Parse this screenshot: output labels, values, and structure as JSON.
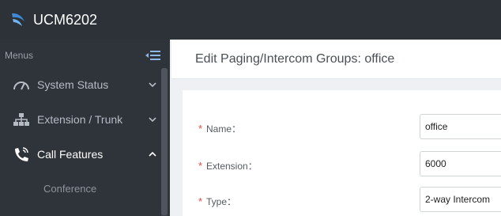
{
  "app": {
    "title": "UCM6202"
  },
  "sidebar": {
    "menus_label": "Menus",
    "items": [
      {
        "label": "System Status",
        "icon": "gauge-icon",
        "expanded": false
      },
      {
        "label": "Extension / Trunk",
        "icon": "network-icon",
        "expanded": false
      },
      {
        "label": "Call Features",
        "icon": "phone-icon",
        "expanded": true
      }
    ],
    "subitems": [
      {
        "label": "Conference"
      }
    ]
  },
  "page": {
    "title": "Edit Paging/Intercom Groups: office"
  },
  "form": {
    "fields": [
      {
        "label": "Name：",
        "value": "office",
        "required": true
      },
      {
        "label": "Extension：",
        "value": "6000",
        "required": true
      },
      {
        "label": "Type：",
        "value": "2-way Intercom",
        "required": true
      }
    ],
    "required_marker": "*"
  },
  "colors": {
    "topbar": "#2d3138",
    "sidebar": "#2f333a",
    "required": "#e14b3b",
    "logo": "#3c8ad8"
  }
}
